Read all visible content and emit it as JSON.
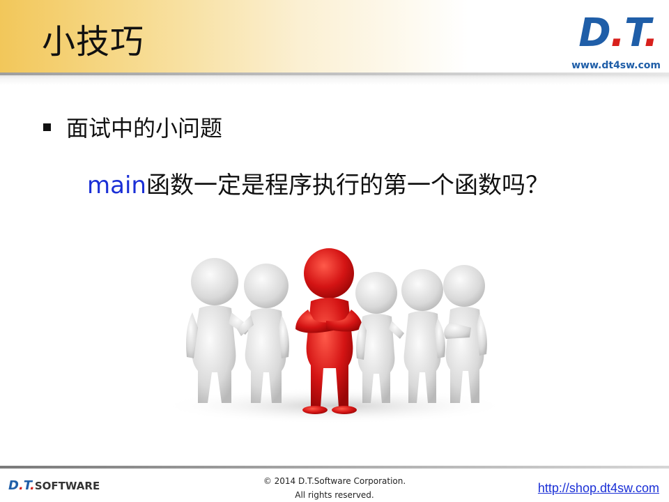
{
  "header": {
    "title": "小技巧",
    "logo": {
      "d": "D",
      "dot1": ".",
      "t": "T",
      "dot2": "."
    },
    "logo_url": "www.dt4sw.com"
  },
  "content": {
    "bullet": "面试中的小问题",
    "question_keyword": "main",
    "question_rest": "函数一定是程序执行的第一个函数吗？"
  },
  "footer": {
    "logo_d": "D",
    "logo_dot1": ".",
    "logo_t": "T",
    "logo_dot2": ".",
    "logo_software": "SOFTWARE",
    "copyright_line1": "© 2014 D.T.Software Corporation.",
    "copyright_line2": "All rights reserved.",
    "shop_link": "http://shop.dt4sw.com"
  },
  "colors": {
    "brand_blue": "#1f5ea8",
    "brand_red": "#d8201c",
    "keyword_blue": "#1a2fd6",
    "figure_red": "#d01010",
    "figure_white": "#e2e2e2"
  }
}
